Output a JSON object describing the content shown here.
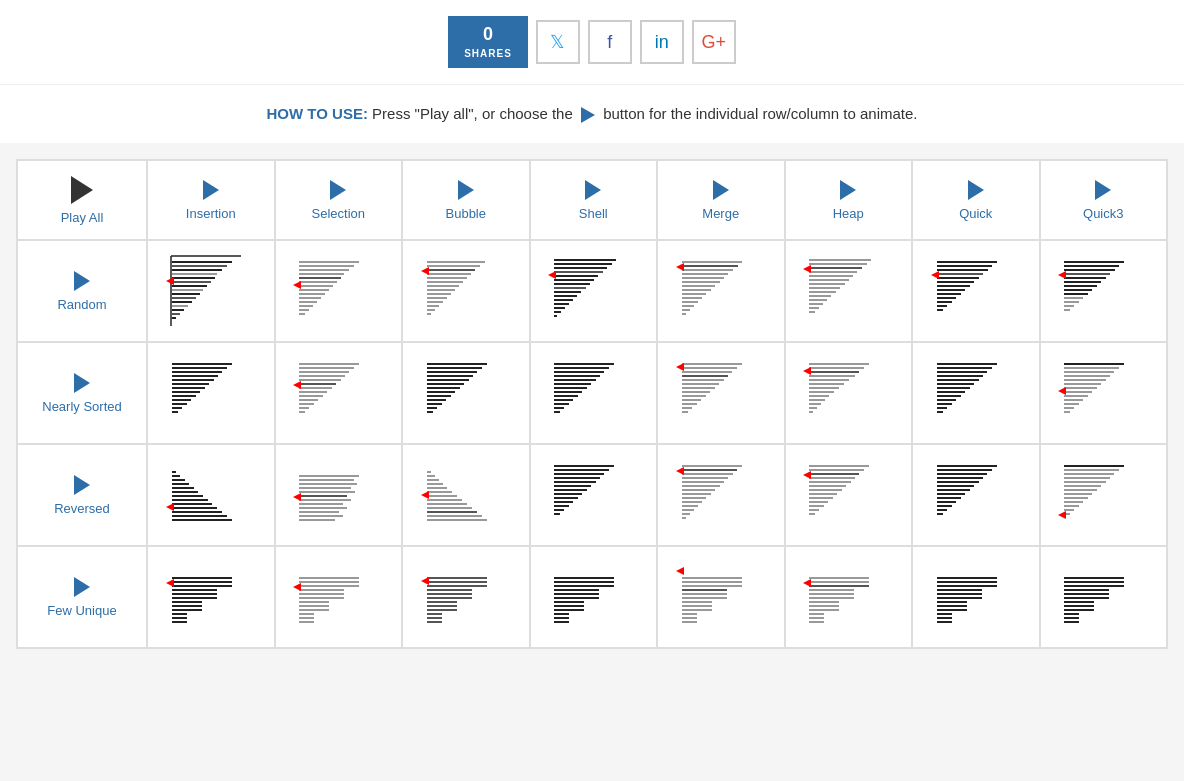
{
  "topbar": {
    "shares_count": "0",
    "shares_label": "SHARES",
    "social_buttons": [
      {
        "id": "twitter",
        "icon": "𝕏",
        "label": "Twitter"
      },
      {
        "id": "facebook",
        "icon": "f",
        "label": "Facebook"
      },
      {
        "id": "linkedin",
        "icon": "in",
        "label": "LinkedIn"
      },
      {
        "id": "googleplus",
        "icon": "G+",
        "label": "Google+"
      }
    ]
  },
  "howto": {
    "prefix": "HOW TO USE:",
    "text": " Press \"Play all\", or choose the ",
    "suffix": " button for the individual row/column to animate."
  },
  "grid": {
    "col_headers": [
      "Play All",
      "Insertion",
      "Selection",
      "Bubble",
      "Shell",
      "Merge",
      "Heap",
      "Quick",
      "Quick3"
    ],
    "row_headers": [
      "Random",
      "Nearly Sorted",
      "Reversed",
      "Few Unique"
    ]
  }
}
